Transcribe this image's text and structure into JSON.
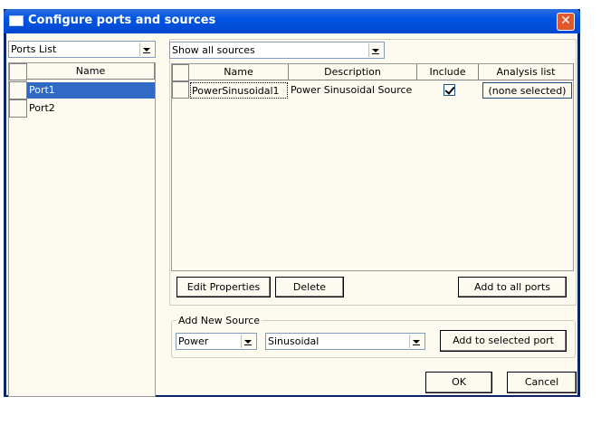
{
  "window": {
    "title": "Configure ports and sources",
    "close_glyph": "✕"
  },
  "ports": {
    "combo_value": "Ports List",
    "column_name": "Name",
    "rows": [
      "Port1",
      "Port2"
    ]
  },
  "sources": {
    "filter_value": "Show all sources",
    "columns": {
      "name": "Name",
      "description": "Description",
      "include": "Include",
      "analysis": "Analysis list"
    },
    "rows": [
      {
        "name": "PowerSinusoidal1",
        "description": "Power Sinusoidal Source",
        "include": true,
        "analysis": "(none selected)"
      }
    ]
  },
  "buttons": {
    "edit_properties": "Edit Properties",
    "delete": "Delete",
    "add_to_all_ports": "Add to all ports",
    "add_to_selected_port": "Add to selected port",
    "ok": "OK",
    "cancel": "Cancel"
  },
  "add_new_source": {
    "label": "Add New Source",
    "type_value": "Power",
    "waveform_value": "Sinusoidal"
  },
  "colors": {
    "selection": "#316ac5",
    "title_bar": "#0054e3",
    "background": "#fdfaf0"
  }
}
